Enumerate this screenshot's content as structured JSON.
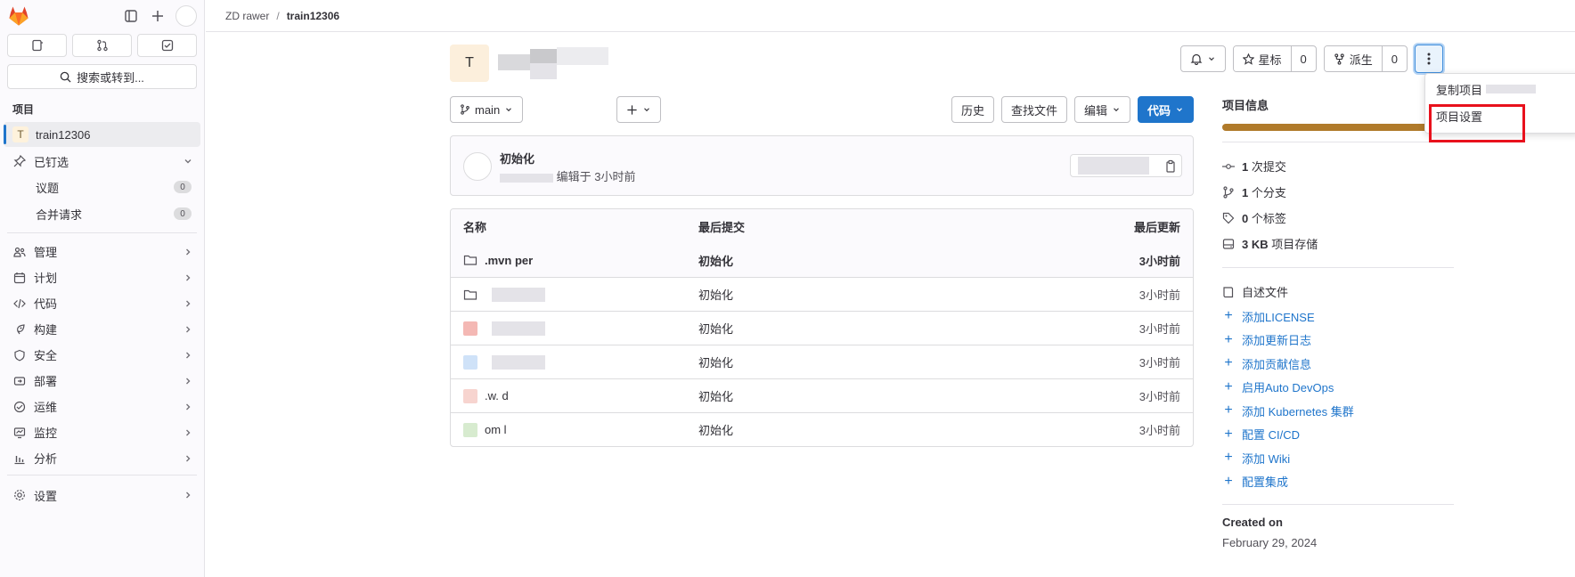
{
  "sidebar": {
    "search_label": "搜索或转到...",
    "section_label": "项目",
    "project": {
      "initial": "T",
      "name": "train12306"
    },
    "pinned": {
      "label": "已钉选",
      "items": [
        {
          "label": "议题",
          "count": "0"
        },
        {
          "label": "合并请求",
          "count": "0"
        }
      ]
    },
    "nav": [
      {
        "label": "管理",
        "icon": "users-icon"
      },
      {
        "label": "计划",
        "icon": "calendar-icon"
      },
      {
        "label": "代码",
        "icon": "code-icon"
      },
      {
        "label": "构建",
        "icon": "rocket-icon"
      },
      {
        "label": "安全",
        "icon": "shield-icon"
      },
      {
        "label": "部署",
        "icon": "deploy-icon"
      },
      {
        "label": "运维",
        "icon": "monitor-icon"
      },
      {
        "label": "监控",
        "icon": "chart-icon"
      },
      {
        "label": "分析",
        "icon": "analytics-icon"
      }
    ],
    "settings_label": "设置"
  },
  "breadcrumb": {
    "group": "ZD rawer",
    "project": "train12306"
  },
  "header": {
    "avatar_letter": "T",
    "star_label": "星标",
    "star_count": "0",
    "fork_label": "派生",
    "fork_count": "0"
  },
  "toolbar": {
    "branch": "main",
    "history": "历史",
    "find_file": "查找文件",
    "edit": "编辑",
    "code": "代码"
  },
  "commit": {
    "title": "初始化",
    "meta": "编辑于 3小时前"
  },
  "file_table": {
    "headers": {
      "name": "名称",
      "last_commit": "最后提交",
      "last_update": "最后更新"
    },
    "rows": [
      {
        "name": ".mvn  per",
        "commit": "初始化",
        "time": "3小时前"
      },
      {
        "name": "",
        "commit": "初始化",
        "time": "3小时前"
      },
      {
        "name": "",
        "commit": "初始化",
        "time": "3小时前"
      },
      {
        "name": "",
        "commit": "初始化",
        "time": "3小时前"
      },
      {
        "name": ".w.  d",
        "commit": "初始化",
        "time": "3小时前"
      },
      {
        "name": "om  l",
        "commit": "初始化",
        "time": "3小时前"
      }
    ]
  },
  "info": {
    "title": "项目信息",
    "lang_color": "#b07a2a",
    "commits": {
      "count": "1",
      "label": "次提交"
    },
    "branches": {
      "count": "1",
      "label": "个分支"
    },
    "tags": {
      "count": "0",
      "label": "个标签"
    },
    "storage": {
      "count": "3 KB",
      "label": "项目存储"
    },
    "readme": "自述文件",
    "links": [
      "添加LICENSE",
      "添加更新日志",
      "添加贡献信息",
      "启用Auto DevOps",
      "添加 Kubernetes 集群",
      "配置 CI/CD",
      "添加 Wiki",
      "配置集成"
    ],
    "created_label": "Created on",
    "created_date": "February 29, 2024"
  },
  "dropdown": {
    "items": [
      "复制项目",
      "项目设置"
    ]
  },
  "colors": {
    "primary": "#1f75cb",
    "highlight": "#e8111c"
  }
}
